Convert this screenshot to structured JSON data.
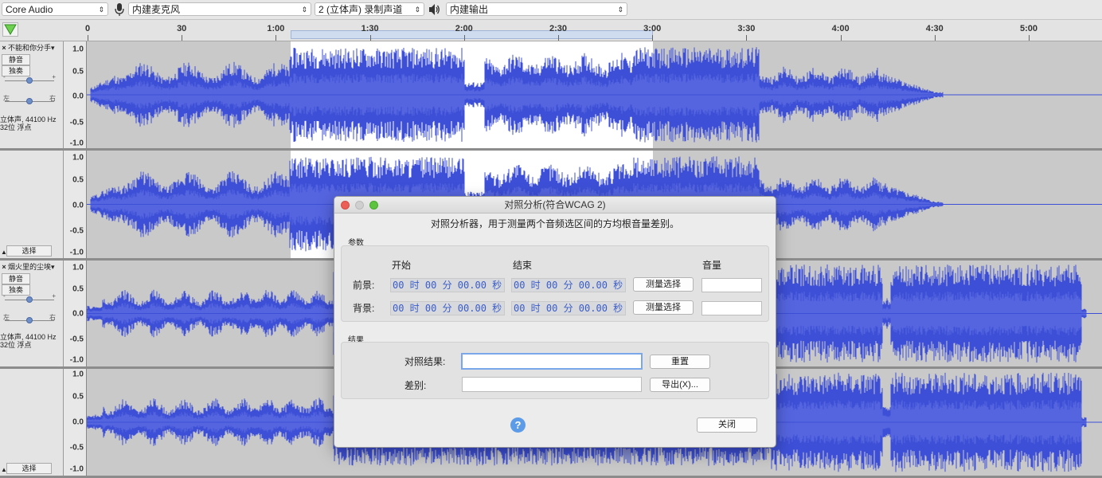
{
  "toolbar": {
    "host": "Core Audio",
    "input_device": "内建麦克风",
    "channels": "2 (立体声) 录制声道",
    "output_device": "内建输出"
  },
  "ruler": {
    "ticks": [
      "0",
      "30",
      "1:00",
      "1:30",
      "2:00",
      "2:30",
      "3:00",
      "3:30",
      "4:00",
      "4:30",
      "5:00"
    ]
  },
  "tracks": [
    {
      "name": "不能和你分手",
      "mute": "静音",
      "solo": "独奏",
      "gain_minus": "-",
      "gain_plus": "+",
      "pan_left": "左",
      "pan_right": "右",
      "info_line1": "立体声, 44100 Hz",
      "info_line2": "32位 浮点",
      "select": "选择",
      "scale": [
        "1.0",
        "0.5",
        "0.0",
        "-0.5",
        "-1.0"
      ]
    },
    {
      "name": "烟火里的尘埃",
      "mute": "静音",
      "solo": "独奏",
      "gain_minus": "-",
      "gain_plus": "+",
      "pan_left": "左",
      "pan_right": "右",
      "info_line1": "立体声, 44100 Hz",
      "info_line2": "32位 浮点",
      "select": "选择",
      "scale": [
        "1.0",
        "0.5",
        "0.0",
        "-0.5",
        "-1.0"
      ]
    }
  ],
  "colors": {
    "waveform": "#3d4fd6",
    "waveform_light": "#5565e0",
    "selection_bg": "#ffffff",
    "track_bg": "#c9c9c9"
  },
  "dialog": {
    "title": "对照分析(符合WCAG 2)",
    "description": "对照分析器，用于测量两个音频选区间的方均根音量差别。",
    "params_label": "参数",
    "col_start": "开始",
    "col_end": "结束",
    "col_volume": "音量",
    "foreground_label": "前景:",
    "background_label": "背景:",
    "fg_start": "00 时 00 分 00.00 秒",
    "fg_end": "00 时 00 分 00.00 秒",
    "bg_start": "00 时 00 分 00.00 秒",
    "bg_end": "00 时 00 分 00.00 秒",
    "measure_label": "测量选择",
    "results_label": "结果",
    "contrast_label": "对照结果:",
    "diff_label": "差别:",
    "reset_label": "重置",
    "export_label": "导出(X)...",
    "close_label": "关闭",
    "help_glyph": "?"
  }
}
